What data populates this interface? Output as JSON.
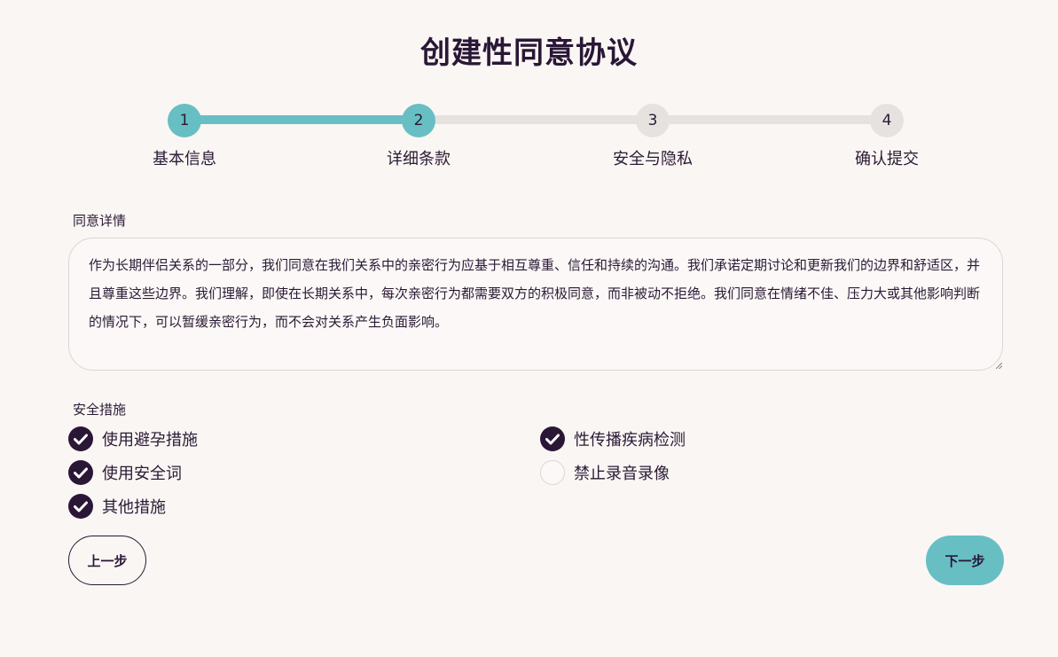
{
  "page": {
    "title": "创建性同意协议"
  },
  "colors": {
    "accent": "#67bfc3",
    "dark": "#2a1736",
    "track": "#e6e2e0",
    "background": "#faf6f4"
  },
  "progress": {
    "current_step": 2,
    "total_steps": 4,
    "steps": [
      {
        "number": "1",
        "label": "基本信息",
        "state": "completed"
      },
      {
        "number": "2",
        "label": "详细条款",
        "state": "current"
      },
      {
        "number": "3",
        "label": "安全与隐私",
        "state": "pending"
      },
      {
        "number": "4",
        "label": "确认提交",
        "state": "pending"
      }
    ]
  },
  "details": {
    "label": "同意详情",
    "value": "作为长期伴侣关系的一部分，我们同意在我们关系中的亲密行为应基于相互尊重、信任和持续的沟通。我们承诺定期讨论和更新我们的边界和舒适区，并且尊重这些边界。我们理解，即使在长期关系中，每次亲密行为都需要双方的积极同意，而非被动不拒绝。我们同意在情绪不佳、压力大或其他影响判断的情况下，可以暂缓亲密行为，而不会对关系产生负面影响。"
  },
  "safety": {
    "label": "安全措施",
    "options": [
      {
        "label": "使用避孕措施",
        "checked": true
      },
      {
        "label": "性传播疾病检测",
        "checked": true
      },
      {
        "label": "使用安全词",
        "checked": true
      },
      {
        "label": "禁止录音录像",
        "checked": false
      },
      {
        "label": "其他措施",
        "checked": true
      }
    ]
  },
  "nav": {
    "prev_label": "上一步",
    "next_label": "下一步"
  }
}
